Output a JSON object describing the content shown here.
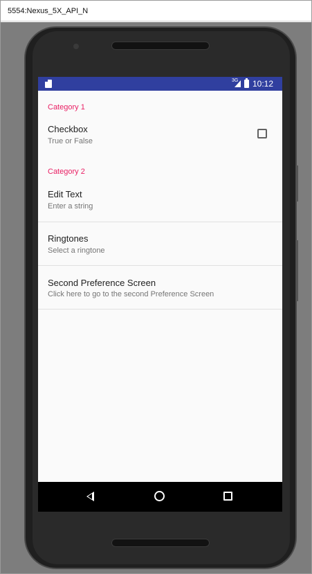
{
  "window": {
    "title": "5554:Nexus_5X_API_N"
  },
  "status_bar": {
    "time": "10:12",
    "network_label": "3G",
    "icons": [
      "sd-card-icon",
      "signal-icon",
      "battery-icon"
    ],
    "color": "#303f9f"
  },
  "preferences": {
    "category1": {
      "title": "Category 1"
    },
    "checkbox": {
      "title": "Checkbox",
      "summary": "True or False",
      "checked": false
    },
    "category2": {
      "title": "Category 2"
    },
    "edit_text": {
      "title": "Edit Text",
      "summary": "Enter a string"
    },
    "ringtones": {
      "title": "Ringtones",
      "summary": "Select a ringtone"
    },
    "second_screen": {
      "title": "Second Preference Screen",
      "summary": "Click here to go to the second Preference Screen"
    }
  },
  "nav_bar": {
    "icons": [
      "back-icon",
      "home-icon",
      "recents-icon"
    ]
  },
  "colors": {
    "accent": "#e91e63",
    "primary_dark": "#303f9f",
    "background": "#fafafa"
  }
}
